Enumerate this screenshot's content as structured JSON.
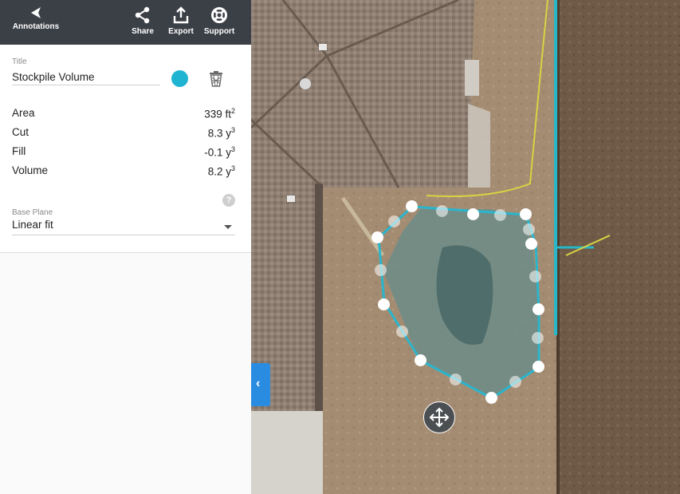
{
  "toolbar": {
    "back_label": "Annotations",
    "share_label": "Share",
    "export_label": "Export",
    "support_label": "Support"
  },
  "annotation": {
    "title_label": "Title",
    "title_value": "Stockpile Volume",
    "color": "#1fb4d2",
    "stats": {
      "area": {
        "label": "Area",
        "value": "339 ft",
        "exp": "2"
      },
      "cut": {
        "label": "Cut",
        "value": "8.3 y",
        "exp": "3"
      },
      "fill": {
        "label": "Fill",
        "value": "-0.1 y",
        "exp": "3"
      },
      "volume": {
        "label": "Volume",
        "value": "8.2 y",
        "exp": "3"
      }
    },
    "help_symbol": "?",
    "base_plane_label": "Base Plane",
    "base_plane_value": "Linear fit"
  },
  "icons": {
    "back": "back-arrow-icon",
    "share": "share-icon",
    "export": "export-icon",
    "support": "lifebuoy-icon",
    "delete": "trash-icon",
    "help": "help-icon",
    "dropdown": "chevron-down-icon",
    "collapse": "chevron-left-icon",
    "move": "move-icon"
  },
  "colors": {
    "toolbar": "#3b4047",
    "accent": "#1fb4d2",
    "collapse_tab": "#2a8ce0",
    "polygon_outline": "#2bb5cc"
  }
}
